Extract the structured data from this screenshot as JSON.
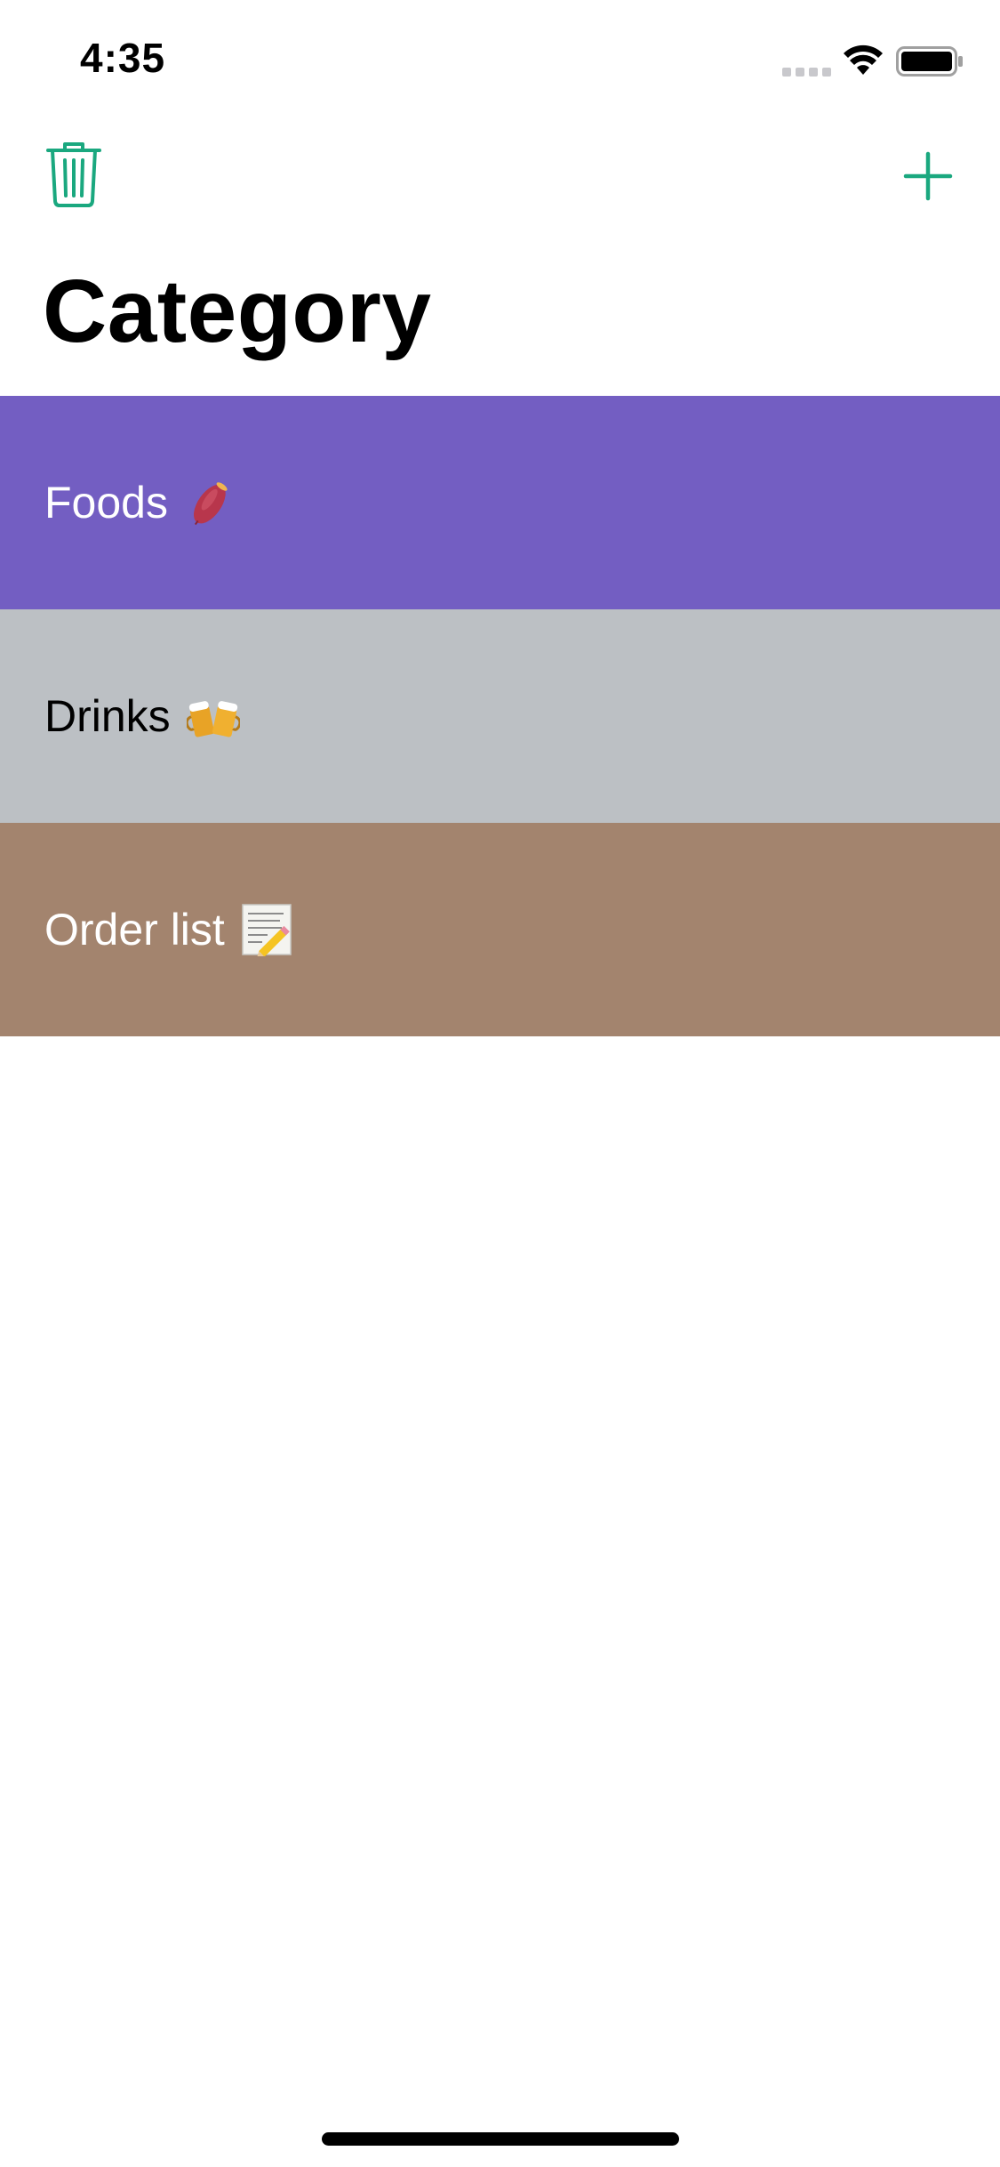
{
  "status_bar": {
    "time": "4:35"
  },
  "nav_bar": {
    "left_icon": "trash-icon",
    "right_icon": "plus-icon",
    "accent_color": "#1aa87f"
  },
  "title": "Category",
  "categories": [
    {
      "label": "Foods",
      "emoji": "sweet-potato-icon",
      "background": "#735ec2",
      "text_color": "#ffffff"
    },
    {
      "label": "Drinks",
      "emoji": "clinking-beer-mugs-icon",
      "background": "#bcc0c4",
      "text_color": "#000000"
    },
    {
      "label": "Order list",
      "emoji": "memo-icon",
      "background": "#a3846e",
      "text_color": "#ffffff"
    }
  ]
}
